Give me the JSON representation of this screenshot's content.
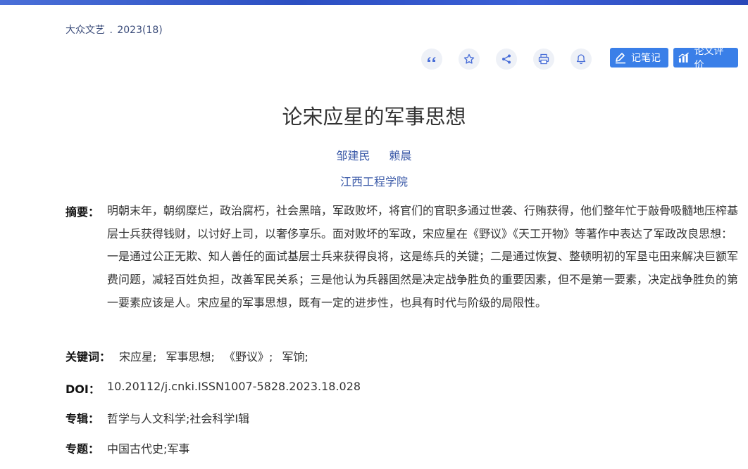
{
  "source": {
    "journal": "大众文艺",
    "separator": ".",
    "issue": "2023(18)"
  },
  "toolbar": {
    "icons": [
      "quote-icon",
      "star-icon",
      "share-icon",
      "print-icon",
      "bell-icon"
    ],
    "note_label": "记笔记",
    "eval_label": "论文评价",
    "accent": "#3a7fe8"
  },
  "paper": {
    "title": "论宋应星的军事思想",
    "authors": [
      "邹建民",
      "赖晨"
    ],
    "org": "江西工程学院"
  },
  "abstract": {
    "label": "摘要：",
    "text": "明朝末年，朝纲糜烂，政治腐朽，社会黑暗，军政败坏，将官们的官职多通过世袭、行贿获得，他们整年忙于敲骨吸髓地压榨基层士兵获得钱财，以讨好上司，以奢侈享乐。面对败坏的军政，宋应星在《野议》《天工开物》等著作中表达了军政改良思想：一是通过公正无欺、知人善任的面试基层士兵来获得良将，这是练兵的关键；二是通过恢复、整顿明初的军垦屯田来解决巨额军费问题，减轻百姓负担，改善军民关系；三是他认为兵器固然是决定战争胜负的重要因素，但不是第一要素，决定战争胜负的第一要素应该是人。宋应星的军事思想，既有一定的进步性，也具有时代与阶级的局限性。"
  },
  "keywords": {
    "label": "关键词：",
    "items": [
      "宋应星;",
      "军事思想;",
      "《野议》;",
      "军饷;"
    ]
  },
  "doi": {
    "label": "DOI：",
    "value": "10.20112/j.cnki.ISSN1007-5828.2023.18.028"
  },
  "album": {
    "label": "专辑：",
    "value": "哲学与人文科学;社会科学Ⅰ辑"
  },
  "topic": {
    "label": "专题：",
    "value": "中国古代史;军事"
  }
}
